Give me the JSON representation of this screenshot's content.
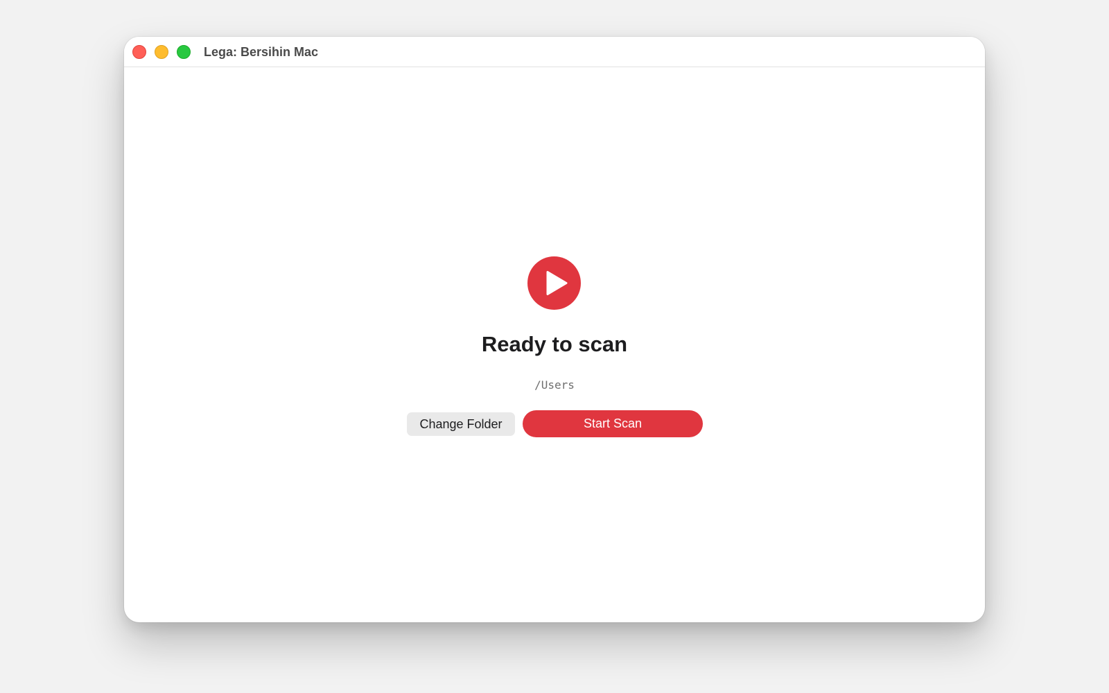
{
  "window": {
    "title": "Lega: Bersihin Mac",
    "traffic_lights": [
      {
        "name": "close",
        "color": "#ff5f57"
      },
      {
        "name": "minimize",
        "color": "#febc2e"
      },
      {
        "name": "maximize",
        "color": "#28c840"
      }
    ]
  },
  "main": {
    "icon": "play-circle-icon",
    "heading": "Ready to scan",
    "path": "/Users",
    "change_folder_label": "Change Folder",
    "start_scan_label": "Start Scan"
  },
  "colors": {
    "accent": "#e0363f",
    "secondary_button": "#e9e9e9",
    "background": "#f2f2f2"
  }
}
